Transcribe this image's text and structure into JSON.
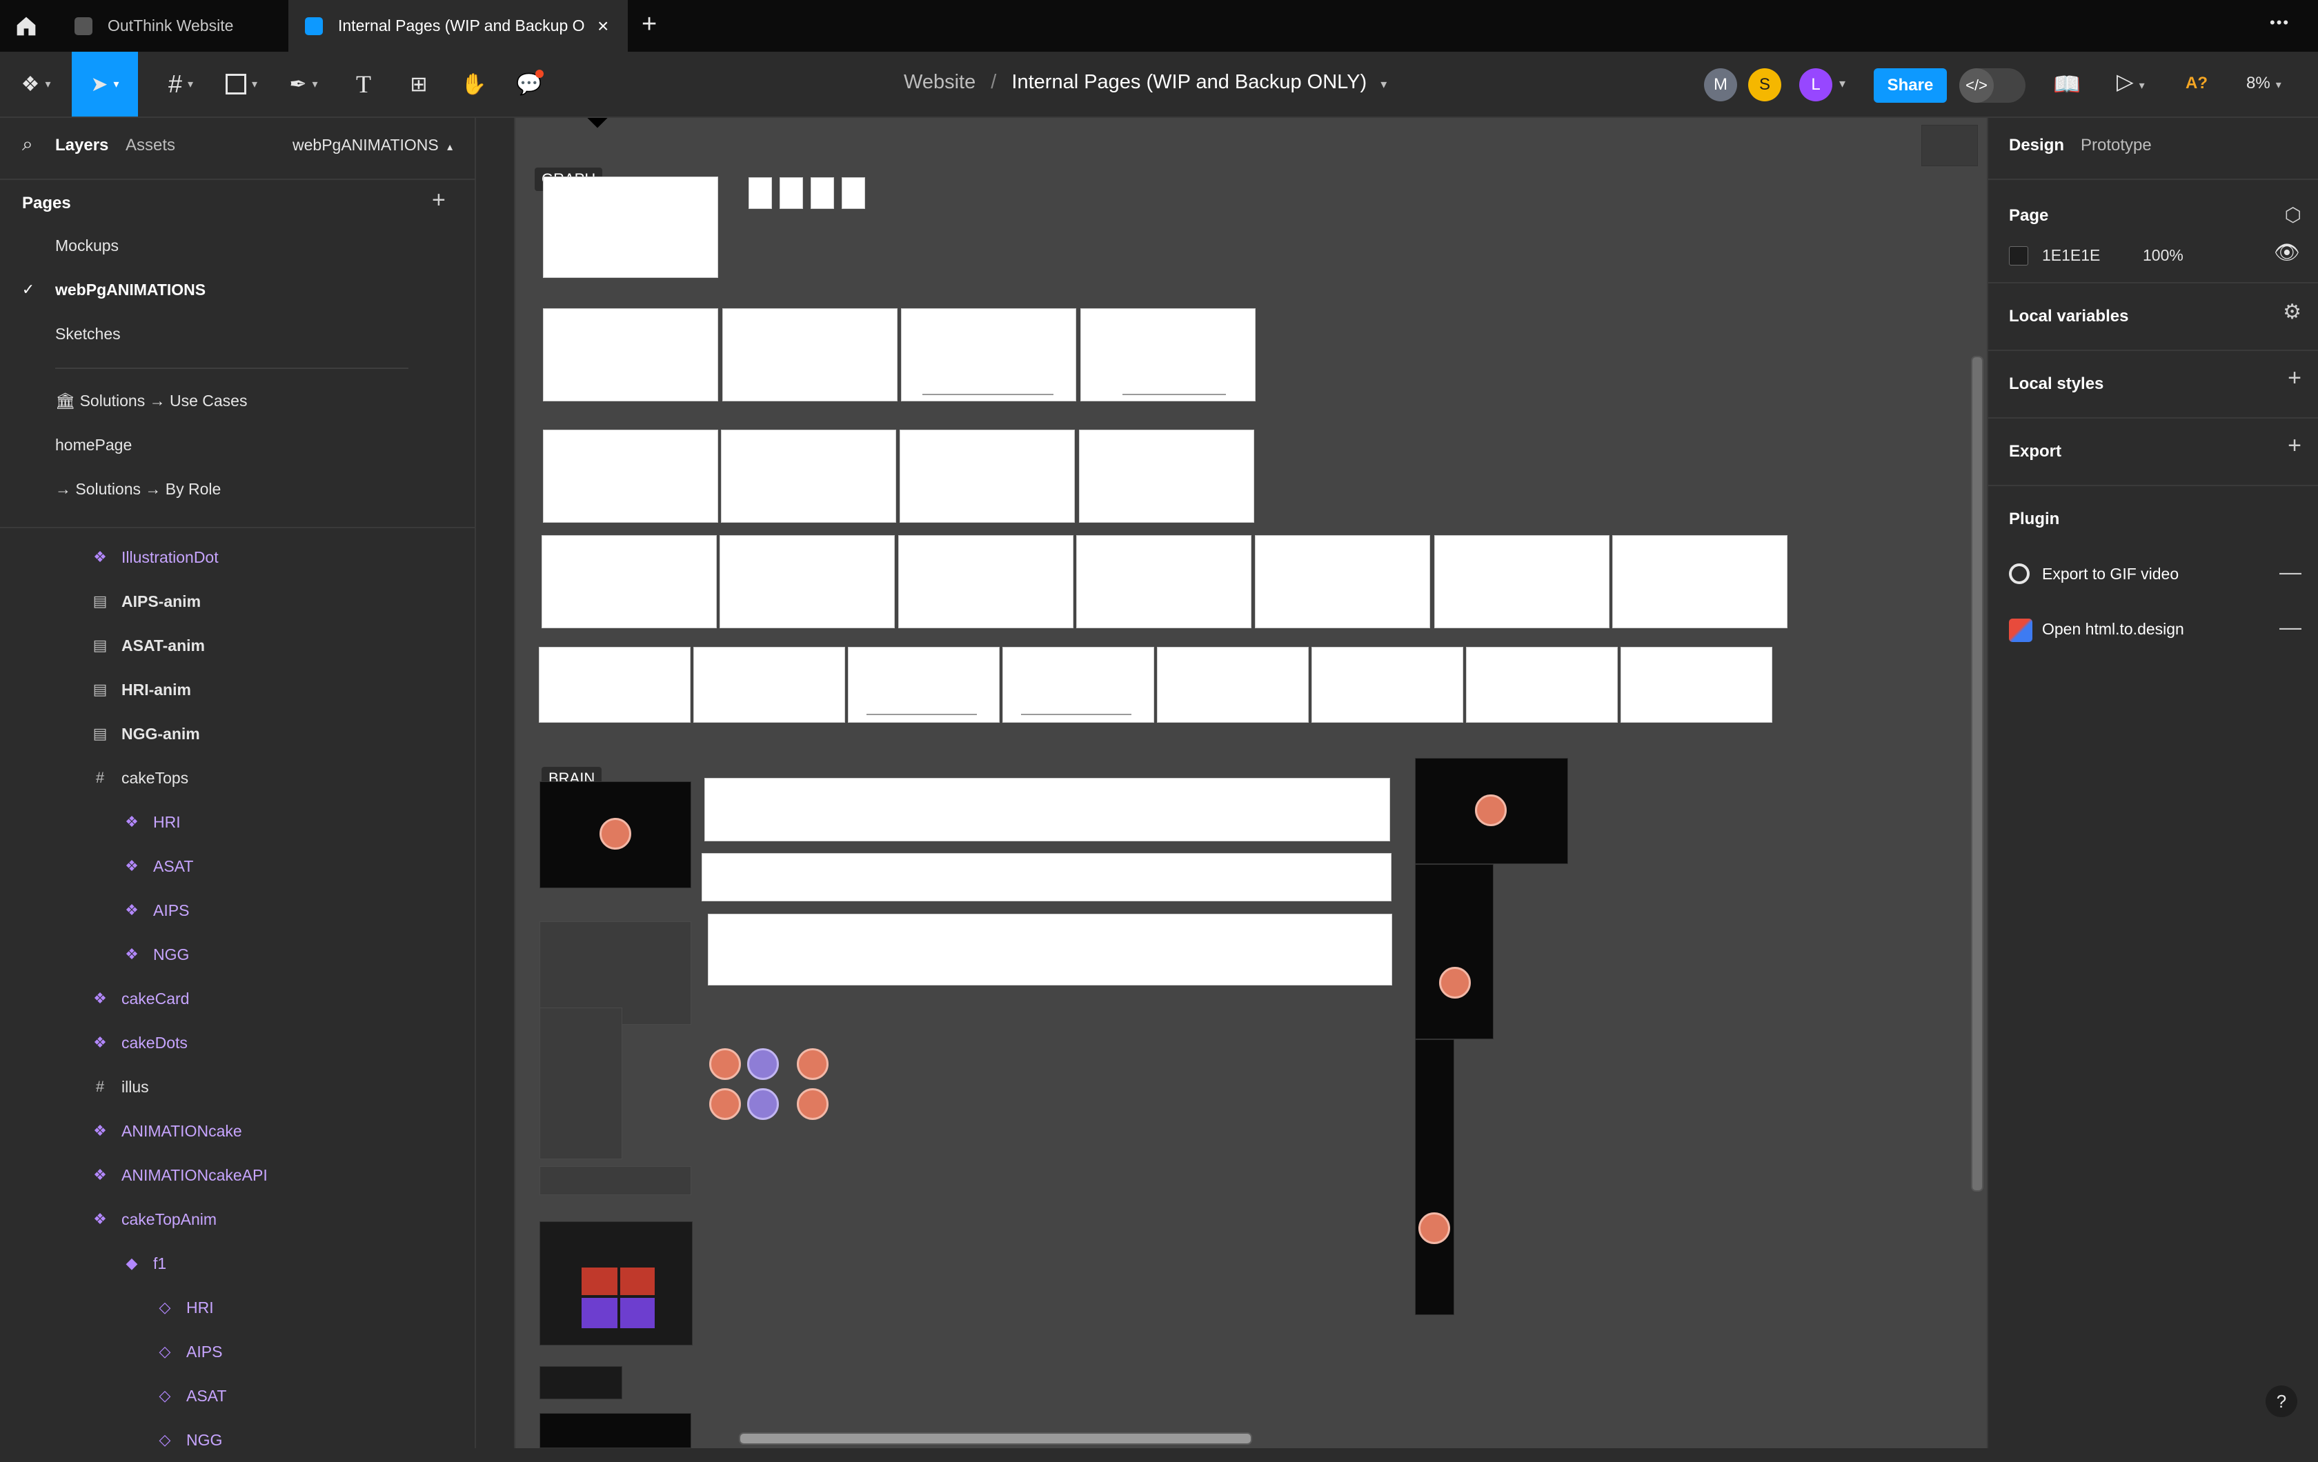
{
  "tabs": {
    "home_icon": "home-icon",
    "items": [
      {
        "label": "OutThink Website"
      },
      {
        "label": "Internal Pages (WIP and Backup O"
      }
    ],
    "new_tab": "+",
    "more": "•••"
  },
  "toolbar": {
    "breadcrumb_project": "Website",
    "breadcrumb_sep": "/",
    "breadcrumb_file": "Internal Pages (WIP and Backup ONLY)",
    "avatars": [
      {
        "initial": "M",
        "color": "#6b7280"
      },
      {
        "initial": "S",
        "color": "#f5b700"
      },
      {
        "initial": "L",
        "color": "#9747ff"
      }
    ],
    "share_label": "Share",
    "ai_label": "A?",
    "zoom": "8%"
  },
  "left": {
    "tabs": {
      "layers": "Layers",
      "assets": "Assets"
    },
    "current_page": "webPgANIMATIONS",
    "pages_heading": "Pages",
    "pages": [
      {
        "label": "Mockups",
        "selected": false
      },
      {
        "label": "webPgANIMATIONS",
        "selected": true
      },
      {
        "label": "Sketches",
        "selected": false
      },
      {
        "label": "🏛 Solutions → Use Cases",
        "selected": false
      },
      {
        "label": "homePage",
        "selected": false
      },
      {
        "label": "→ Solutions → By Role",
        "selected": false
      }
    ],
    "layers": [
      {
        "label": "IllustrationDot",
        "icon": "component-icon",
        "kind": "component",
        "indent": 0
      },
      {
        "label": "AIPS-anim",
        "icon": "frame-icon",
        "kind": "frame",
        "indent": 0
      },
      {
        "label": "ASAT-anim",
        "icon": "frame-icon",
        "kind": "frame",
        "indent": 0
      },
      {
        "label": "HRI-anim",
        "icon": "frame-icon",
        "kind": "frame",
        "indent": 0
      },
      {
        "label": "NGG-anim",
        "icon": "frame-icon",
        "kind": "frame",
        "indent": 0
      },
      {
        "label": "cakeTops",
        "icon": "hash-frame-icon",
        "kind": "plain",
        "indent": 0
      },
      {
        "label": "HRI",
        "icon": "component-icon",
        "kind": "component",
        "indent": 1
      },
      {
        "label": "ASAT",
        "icon": "component-icon",
        "kind": "component",
        "indent": 1
      },
      {
        "label": "AIPS",
        "icon": "component-icon",
        "kind": "component",
        "indent": 1
      },
      {
        "label": "NGG",
        "icon": "component-icon",
        "kind": "component",
        "indent": 1
      },
      {
        "label": "cakeCard",
        "icon": "component-icon",
        "kind": "component",
        "indent": 0
      },
      {
        "label": "cakeDots",
        "icon": "component-icon",
        "kind": "component",
        "indent": 0
      },
      {
        "label": "illus",
        "icon": "hash-frame-icon",
        "kind": "plain",
        "indent": 0
      },
      {
        "label": "ANIMATIONcake",
        "icon": "component-icon",
        "kind": "component",
        "indent": 0
      },
      {
        "label": "ANIMATIONcakeAPI",
        "icon": "component-icon",
        "kind": "component",
        "indent": 0
      },
      {
        "label": "cakeTopAnim",
        "icon": "component-icon",
        "kind": "component",
        "indent": 0
      },
      {
        "label": "f1",
        "icon": "variant-icon",
        "kind": "component",
        "indent": 1
      },
      {
        "label": "HRI",
        "icon": "instance-icon",
        "kind": "component",
        "indent": 2
      },
      {
        "label": "AIPS",
        "icon": "instance-icon",
        "kind": "component",
        "indent": 2
      },
      {
        "label": "ASAT",
        "icon": "instance-icon",
        "kind": "component",
        "indent": 2
      },
      {
        "label": "NGG",
        "icon": "instance-icon",
        "kind": "component",
        "indent": 2
      }
    ]
  },
  "canvas": {
    "label_graph": "GRAPH",
    "label_brain": "BRAIN",
    "background": "#454545"
  },
  "right": {
    "tabs": {
      "design": "Design",
      "prototype": "Prototype"
    },
    "page_heading": "Page",
    "page_color_hex": "1E1E1E",
    "page_color_swatch": "#1e1e1e",
    "page_opacity": "100%",
    "local_variables": "Local variables",
    "local_styles": "Local styles",
    "export": "Export",
    "plugin_heading": "Plugin",
    "plugins": [
      {
        "label": "Export to GIF video",
        "icon": "gif-plugin-icon"
      },
      {
        "label": "Open html.to.design",
        "icon": "html-to-design-plugin-icon"
      }
    ]
  },
  "help": "?"
}
